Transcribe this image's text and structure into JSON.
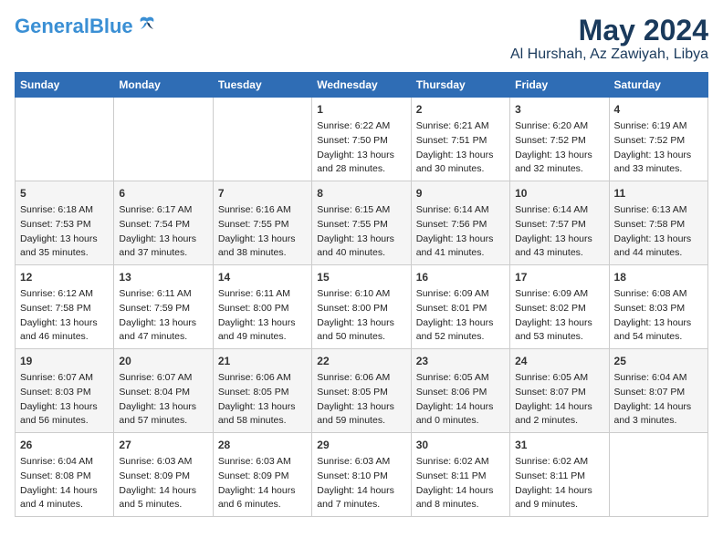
{
  "header": {
    "logo_line1": "General",
    "logo_line2": "Blue",
    "title": "May 2024",
    "subtitle": "Al Hurshah, Az Zawiyah, Libya"
  },
  "weekdays": [
    "Sunday",
    "Monday",
    "Tuesday",
    "Wednesday",
    "Thursday",
    "Friday",
    "Saturday"
  ],
  "weeks": [
    [
      {
        "day": "",
        "info": ""
      },
      {
        "day": "",
        "info": ""
      },
      {
        "day": "",
        "info": ""
      },
      {
        "day": "1",
        "info": "Sunrise: 6:22 AM\nSunset: 7:50 PM\nDaylight: 13 hours\nand 28 minutes."
      },
      {
        "day": "2",
        "info": "Sunrise: 6:21 AM\nSunset: 7:51 PM\nDaylight: 13 hours\nand 30 minutes."
      },
      {
        "day": "3",
        "info": "Sunrise: 6:20 AM\nSunset: 7:52 PM\nDaylight: 13 hours\nand 32 minutes."
      },
      {
        "day": "4",
        "info": "Sunrise: 6:19 AM\nSunset: 7:52 PM\nDaylight: 13 hours\nand 33 minutes."
      }
    ],
    [
      {
        "day": "5",
        "info": "Sunrise: 6:18 AM\nSunset: 7:53 PM\nDaylight: 13 hours\nand 35 minutes."
      },
      {
        "day": "6",
        "info": "Sunrise: 6:17 AM\nSunset: 7:54 PM\nDaylight: 13 hours\nand 37 minutes."
      },
      {
        "day": "7",
        "info": "Sunrise: 6:16 AM\nSunset: 7:55 PM\nDaylight: 13 hours\nand 38 minutes."
      },
      {
        "day": "8",
        "info": "Sunrise: 6:15 AM\nSunset: 7:55 PM\nDaylight: 13 hours\nand 40 minutes."
      },
      {
        "day": "9",
        "info": "Sunrise: 6:14 AM\nSunset: 7:56 PM\nDaylight: 13 hours\nand 41 minutes."
      },
      {
        "day": "10",
        "info": "Sunrise: 6:14 AM\nSunset: 7:57 PM\nDaylight: 13 hours\nand 43 minutes."
      },
      {
        "day": "11",
        "info": "Sunrise: 6:13 AM\nSunset: 7:58 PM\nDaylight: 13 hours\nand 44 minutes."
      }
    ],
    [
      {
        "day": "12",
        "info": "Sunrise: 6:12 AM\nSunset: 7:58 PM\nDaylight: 13 hours\nand 46 minutes."
      },
      {
        "day": "13",
        "info": "Sunrise: 6:11 AM\nSunset: 7:59 PM\nDaylight: 13 hours\nand 47 minutes."
      },
      {
        "day": "14",
        "info": "Sunrise: 6:11 AM\nSunset: 8:00 PM\nDaylight: 13 hours\nand 49 minutes."
      },
      {
        "day": "15",
        "info": "Sunrise: 6:10 AM\nSunset: 8:00 PM\nDaylight: 13 hours\nand 50 minutes."
      },
      {
        "day": "16",
        "info": "Sunrise: 6:09 AM\nSunset: 8:01 PM\nDaylight: 13 hours\nand 52 minutes."
      },
      {
        "day": "17",
        "info": "Sunrise: 6:09 AM\nSunset: 8:02 PM\nDaylight: 13 hours\nand 53 minutes."
      },
      {
        "day": "18",
        "info": "Sunrise: 6:08 AM\nSunset: 8:03 PM\nDaylight: 13 hours\nand 54 minutes."
      }
    ],
    [
      {
        "day": "19",
        "info": "Sunrise: 6:07 AM\nSunset: 8:03 PM\nDaylight: 13 hours\nand 56 minutes."
      },
      {
        "day": "20",
        "info": "Sunrise: 6:07 AM\nSunset: 8:04 PM\nDaylight: 13 hours\nand 57 minutes."
      },
      {
        "day": "21",
        "info": "Sunrise: 6:06 AM\nSunset: 8:05 PM\nDaylight: 13 hours\nand 58 minutes."
      },
      {
        "day": "22",
        "info": "Sunrise: 6:06 AM\nSunset: 8:05 PM\nDaylight: 13 hours\nand 59 minutes."
      },
      {
        "day": "23",
        "info": "Sunrise: 6:05 AM\nSunset: 8:06 PM\nDaylight: 14 hours\nand 0 minutes."
      },
      {
        "day": "24",
        "info": "Sunrise: 6:05 AM\nSunset: 8:07 PM\nDaylight: 14 hours\nand 2 minutes."
      },
      {
        "day": "25",
        "info": "Sunrise: 6:04 AM\nSunset: 8:07 PM\nDaylight: 14 hours\nand 3 minutes."
      }
    ],
    [
      {
        "day": "26",
        "info": "Sunrise: 6:04 AM\nSunset: 8:08 PM\nDaylight: 14 hours\nand 4 minutes."
      },
      {
        "day": "27",
        "info": "Sunrise: 6:03 AM\nSunset: 8:09 PM\nDaylight: 14 hours\nand 5 minutes."
      },
      {
        "day": "28",
        "info": "Sunrise: 6:03 AM\nSunset: 8:09 PM\nDaylight: 14 hours\nand 6 minutes."
      },
      {
        "day": "29",
        "info": "Sunrise: 6:03 AM\nSunset: 8:10 PM\nDaylight: 14 hours\nand 7 minutes."
      },
      {
        "day": "30",
        "info": "Sunrise: 6:02 AM\nSunset: 8:11 PM\nDaylight: 14 hours\nand 8 minutes."
      },
      {
        "day": "31",
        "info": "Sunrise: 6:02 AM\nSunset: 8:11 PM\nDaylight: 14 hours\nand 9 minutes."
      },
      {
        "day": "",
        "info": ""
      }
    ]
  ]
}
